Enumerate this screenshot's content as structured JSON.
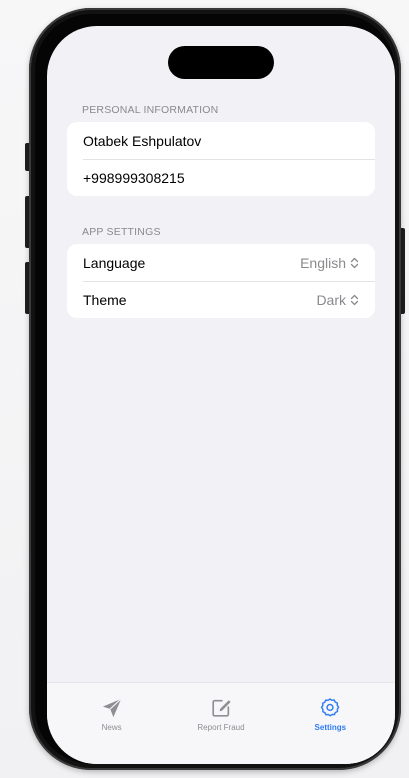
{
  "sections": {
    "personal": {
      "header": "PERSONAL INFORMATION",
      "name": "Otabek Eshpulatov",
      "phone": "+998999308215"
    },
    "app_settings": {
      "header": "APP SETTINGS",
      "language": {
        "label": "Language",
        "value": "English"
      },
      "theme": {
        "label": "Theme",
        "value": "Dark"
      }
    }
  },
  "tabbar": {
    "tabs": [
      {
        "label": "News",
        "icon": "paperplane-icon",
        "active": false
      },
      {
        "label": "Report Fraud",
        "icon": "square-pencil-icon",
        "active": false
      },
      {
        "label": "Settings",
        "icon": "gear-icon",
        "active": true
      }
    ]
  },
  "colors": {
    "accent": "#2f7cf6",
    "inactive": "#8e8e93",
    "background": "#f2f2f6",
    "card": "#ffffff"
  }
}
